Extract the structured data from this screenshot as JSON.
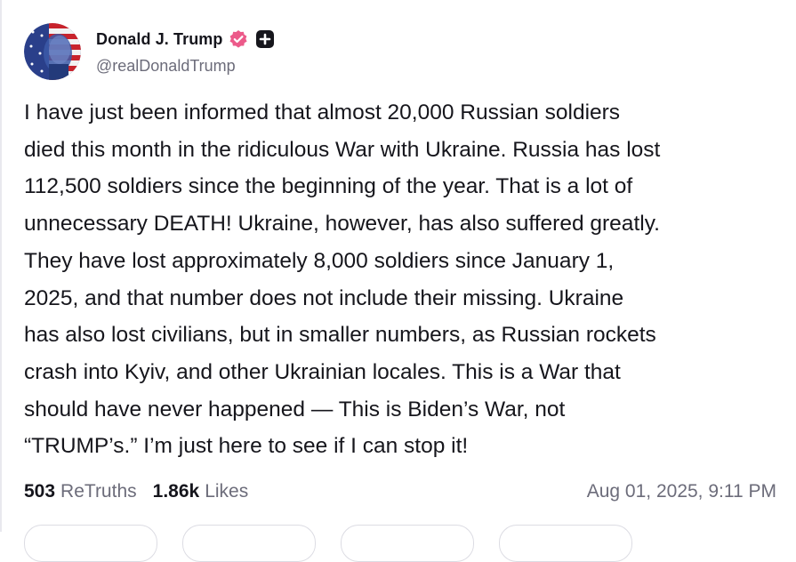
{
  "author": {
    "display_name": "Donald J. Trump",
    "handle": "@realDonaldTrump",
    "verified_color": "#ec5a8a"
  },
  "post": {
    "lines": [
      "I have just been informed that almost 20,000 Russian soldiers",
      "died this month in the ridiculous War with Ukraine. Russia has lost",
      "112,500 soldiers since the beginning of the year. That is a lot of",
      "unnecessary DEATH! Ukraine, however, has also suffered greatly.",
      "They have lost approximately 8,000 soldiers since January 1,",
      "2025, and that number does not include their missing. Ukraine",
      "has also lost civilians, but in smaller numbers, as Russian rockets",
      "crash into Kyiv, and other Ukrainian locales. This is a War that",
      "should have never happened — This is Biden’s War, not",
      "“TRUMP’s.” I’m just here to see if I can stop it!"
    ]
  },
  "stats": {
    "retruths_count": "503",
    "retruths_label": "ReTruths",
    "likes_count": "1.86k",
    "likes_label": "Likes",
    "timestamp": "Aug 01, 2025, 9:11 PM"
  },
  "icons": {
    "verified": "verified-badge-icon",
    "plus": "plus-badge-icon"
  }
}
